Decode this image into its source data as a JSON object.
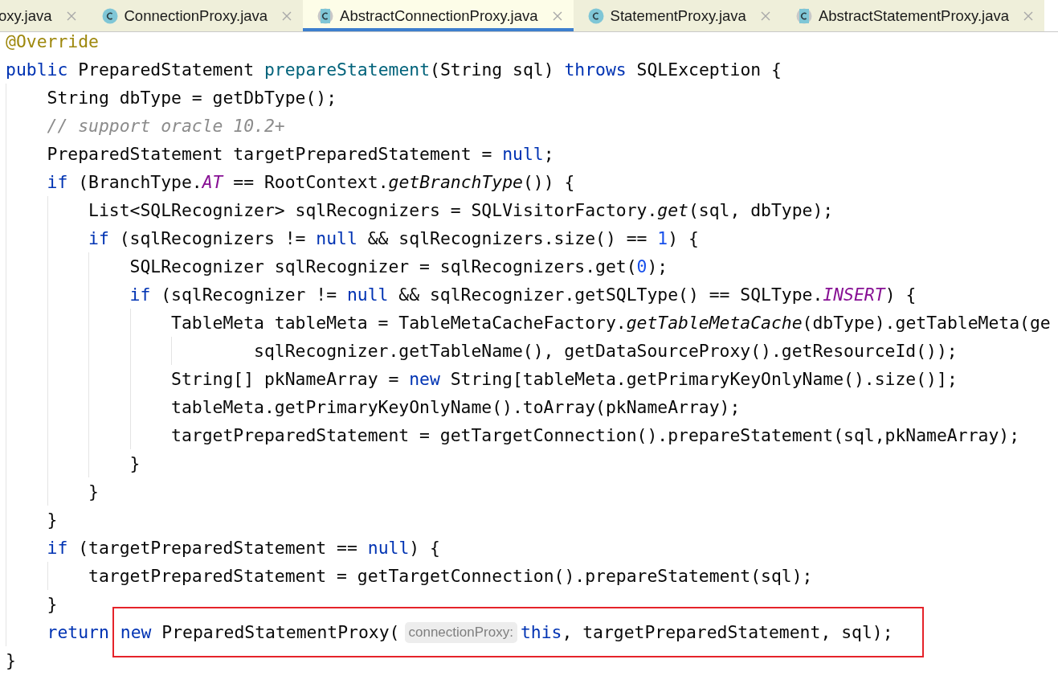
{
  "tabs": [
    {
      "label": "oxy.java",
      "selected": false,
      "kind": "plain"
    },
    {
      "label": "ConnectionProxy.java",
      "selected": false,
      "kind": "class"
    },
    {
      "label": "AbstractConnectionProxy.java",
      "selected": true,
      "kind": "abstract"
    },
    {
      "label": "StatementProxy.java",
      "selected": false,
      "kind": "class"
    },
    {
      "label": "AbstractStatementProxy.java",
      "selected": false,
      "kind": "abstract"
    }
  ],
  "code": [
    {
      "tokens": [
        {
          "kind": "annotation",
          "text": "@Override"
        }
      ]
    },
    {
      "tokens": [
        {
          "kind": "keyword",
          "text": "public"
        },
        {
          "kind": "plain",
          "text": " PreparedStatement "
        },
        {
          "kind": "decl",
          "text": "prepareStatement"
        },
        {
          "kind": "plain",
          "text": "(String sql) "
        },
        {
          "kind": "keyword",
          "text": "throws"
        },
        {
          "kind": "plain",
          "text": " SQLException {"
        }
      ],
      "children": [
        {
          "tokens": [
            {
              "kind": "plain",
              "text": "String dbType = getDbType();"
            }
          ]
        },
        {
          "tokens": [
            {
              "kind": "comment",
              "text": "// support oracle 10.2+"
            }
          ]
        },
        {
          "tokens": [
            {
              "kind": "plain",
              "text": "PreparedStatement targetPreparedStatement = "
            },
            {
              "kind": "keyword",
              "text": "null"
            },
            {
              "kind": "plain",
              "text": ";"
            }
          ]
        },
        {
          "tokens": [
            {
              "kind": "keyword",
              "text": "if"
            },
            {
              "kind": "plain",
              "text": " (BranchType."
            },
            {
              "kind": "constant",
              "text": "AT"
            },
            {
              "kind": "plain",
              "text": " == RootContext."
            },
            {
              "kind": "static",
              "text": "getBranchType"
            },
            {
              "kind": "plain",
              "text": "()) {"
            }
          ],
          "children": [
            {
              "tokens": [
                {
                  "kind": "plain",
                  "text": "List<SQLRecognizer> sqlRecognizers = SQLVisitorFactory."
                },
                {
                  "kind": "static",
                  "text": "get"
                },
                {
                  "kind": "plain",
                  "text": "(sql, dbType);"
                }
              ]
            },
            {
              "tokens": [
                {
                  "kind": "keyword",
                  "text": "if"
                },
                {
                  "kind": "plain",
                  "text": " (sqlRecognizers != "
                },
                {
                  "kind": "keyword",
                  "text": "null"
                },
                {
                  "kind": "plain",
                  "text": " && sqlRecognizers.size() == "
                },
                {
                  "kind": "number",
                  "text": "1"
                },
                {
                  "kind": "plain",
                  "text": ") {"
                }
              ],
              "children": [
                {
                  "tokens": [
                    {
                      "kind": "plain",
                      "text": "SQLRecognizer sqlRecognizer = sqlRecognizers.get("
                    },
                    {
                      "kind": "number",
                      "text": "0"
                    },
                    {
                      "kind": "plain",
                      "text": ");"
                    }
                  ]
                },
                {
                  "tokens": [
                    {
                      "kind": "keyword",
                      "text": "if"
                    },
                    {
                      "kind": "plain",
                      "text": " (sqlRecognizer != "
                    },
                    {
                      "kind": "keyword",
                      "text": "null"
                    },
                    {
                      "kind": "plain",
                      "text": " && sqlRecognizer.getSQLType() == SQLType."
                    },
                    {
                      "kind": "constant",
                      "text": "INSERT"
                    },
                    {
                      "kind": "plain",
                      "text": ") {"
                    }
                  ],
                  "children": [
                    {
                      "tokens": [
                        {
                          "kind": "plain",
                          "text": "TableMeta tableMeta = TableMetaCacheFactory."
                        },
                        {
                          "kind": "static",
                          "text": "getTableMetaCache"
                        },
                        {
                          "kind": "plain",
                          "text": "(dbType).getTableMeta(ge"
                        }
                      ],
                      "continuation": [
                        {
                          "kind": "plain",
                          "text": "sqlRecognizer.getTableName(), getDataSourceProxy().getResourceId());"
                        }
                      ]
                    },
                    {
                      "tokens": [
                        {
                          "kind": "plain",
                          "text": "String[] pkNameArray = "
                        },
                        {
                          "kind": "keyword",
                          "text": "new"
                        },
                        {
                          "kind": "plain",
                          "text": " String[tableMeta.getPrimaryKeyOnlyName().size()];"
                        }
                      ]
                    },
                    {
                      "tokens": [
                        {
                          "kind": "plain",
                          "text": "tableMeta.getPrimaryKeyOnlyName().toArray(pkNameArray);"
                        }
                      ]
                    },
                    {
                      "tokens": [
                        {
                          "kind": "plain",
                          "text": "targetPreparedStatement = getTargetConnection().prepareStatement(sql,pkNameArray);"
                        }
                      ]
                    }
                  ]
                },
                {
                  "tokens": [
                    {
                      "kind": "plain",
                      "text": "}"
                    }
                  ]
                }
              ]
            },
            {
              "tokens": [
                {
                  "kind": "plain",
                  "text": "}"
                }
              ]
            }
          ]
        },
        {
          "tokens": [
            {
              "kind": "plain",
              "text": "}"
            }
          ]
        },
        {
          "tokens": [
            {
              "kind": "keyword",
              "text": "if"
            },
            {
              "kind": "plain",
              "text": " (targetPreparedStatement == "
            },
            {
              "kind": "keyword",
              "text": "null"
            },
            {
              "kind": "plain",
              "text": ") {"
            }
          ],
          "children": [
            {
              "tokens": [
                {
                  "kind": "plain",
                  "text": "targetPreparedStatement = getTargetConnection().prepareStatement(sql);"
                }
              ]
            }
          ]
        },
        {
          "tokens": [
            {
              "kind": "plain",
              "text": "}"
            }
          ]
        },
        {
          "tokens": [
            {
              "kind": "keyword",
              "text": "return"
            }
          ],
          "boxed": [
            {
              "kind": "keyword",
              "text": "new"
            },
            {
              "kind": "plain",
              "text": " PreparedStatementProxy("
            },
            {
              "kind": "hint",
              "text": "connectionProxy:"
            },
            {
              "kind": "keyword",
              "text": "this"
            },
            {
              "kind": "plain",
              "text": ", targetPreparedStatement, sql);"
            }
          ]
        }
      ]
    },
    {
      "tokens": [
        {
          "kind": "plain",
          "text": "}"
        }
      ]
    }
  ]
}
